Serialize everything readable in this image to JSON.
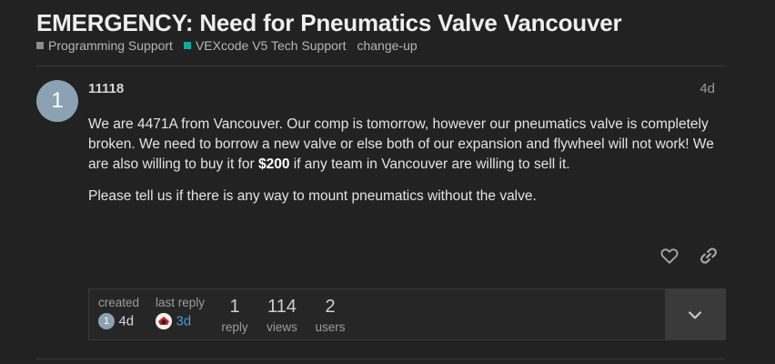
{
  "topic": {
    "title": "EMERGENCY: Need for Pneumatics Valve Vancouver",
    "categories": [
      {
        "label": "Programming Support",
        "color": "#8c8c8c"
      },
      {
        "label": "VEXcode V5 Tech Support",
        "color": "#12a89d"
      }
    ],
    "tag": "change-up"
  },
  "post": {
    "avatar_letter": "1",
    "username": "11118",
    "date": "4d",
    "paragraph1_before": "We are 4471A from Vancouver. Our comp is tomorrow, however our pneumatics valve is completely broken. We need to borrow a new valve or else both of our expansion and flywheel will not work! We are also willing to buy it for ",
    "paragraph1_bold": "$200",
    "paragraph1_after": " if any team in Vancouver are willing to sell it.",
    "paragraph2": "Please tell us if there is any way to mount pneumatics without the valve.",
    "actions": {
      "like_icon": "heart-icon",
      "share_icon": "link-icon"
    }
  },
  "topic_map": {
    "created_label": "created",
    "created_avatar_letter": "1",
    "created_value": "4d",
    "last_reply_label": "last reply",
    "last_reply_value": "3d",
    "reply_count": "1",
    "reply_label": "reply",
    "views_count": "114",
    "views_label": "views",
    "users_count": "2",
    "users_label": "users",
    "expand_icon": "chevron-down-icon",
    "link_color": "#3aa0d8"
  }
}
